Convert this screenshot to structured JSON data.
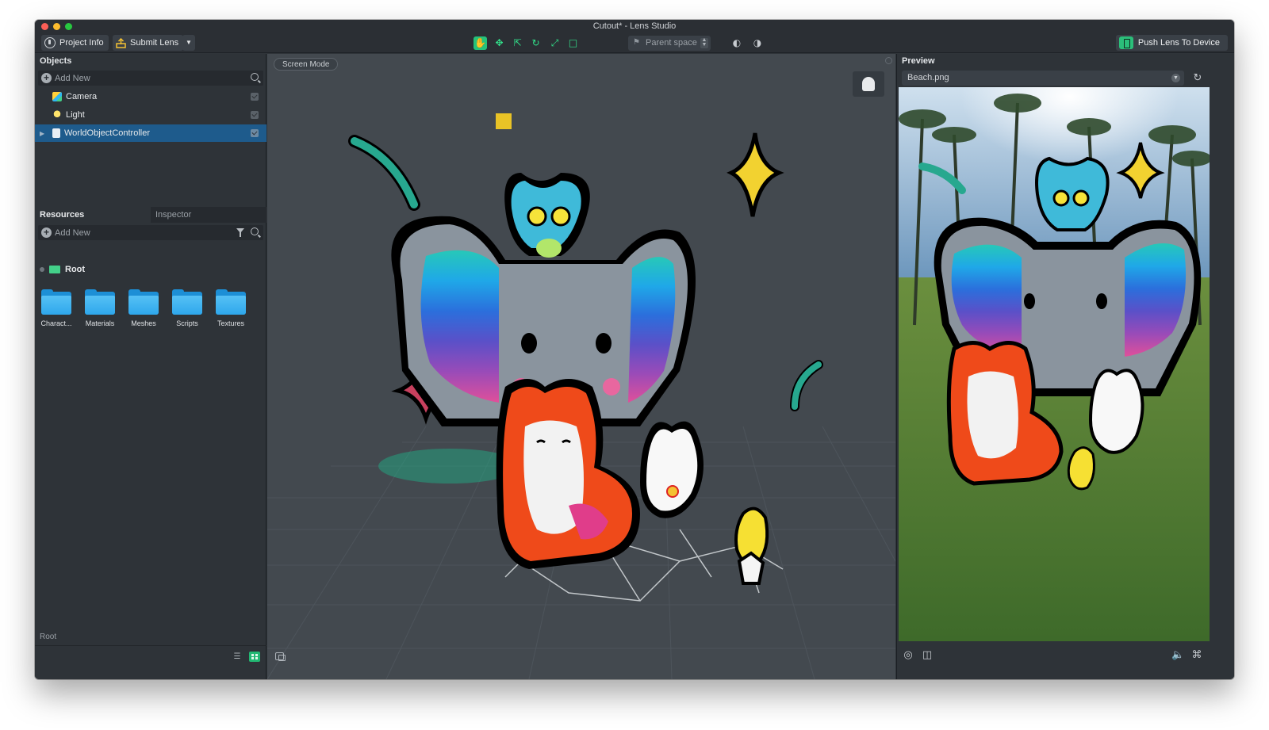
{
  "window": {
    "title": "Cutout* - Lens Studio"
  },
  "toolbar": {
    "project_info": "Project Info",
    "submit_lens": "Submit Lens",
    "parent_space": "Parent space",
    "push_lens": "Push Lens To Device"
  },
  "objects": {
    "title": "Objects",
    "add_new": "Add New",
    "items": [
      {
        "label": "Camera",
        "icon": "camera-icon"
      },
      {
        "label": "Light",
        "icon": "light-bulb-icon"
      },
      {
        "label": "WorldObjectController",
        "icon": "script-icon",
        "selected": true
      }
    ]
  },
  "resources": {
    "tab_resources": "Resources",
    "tab_inspector": "Inspector",
    "add_new": "Add New",
    "root": "Root",
    "folders": [
      "Charact...",
      "Materials",
      "Meshes",
      "Scripts",
      "Textures"
    ],
    "footer_path": "Root"
  },
  "scene": {
    "screen_mode": "Screen Mode"
  },
  "preview": {
    "title": "Preview",
    "background": "Beach.png"
  },
  "colors": {
    "accent_green": "#25c27a",
    "selection_blue": "#1e5b8c",
    "folder_blue": "#2ea7ec"
  }
}
